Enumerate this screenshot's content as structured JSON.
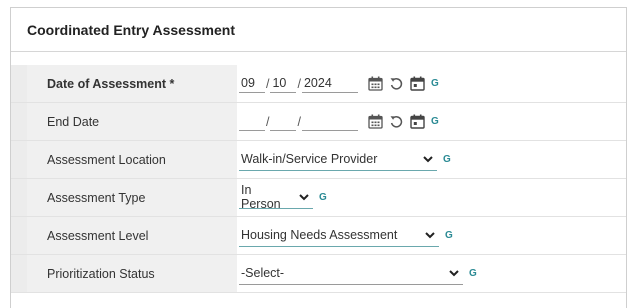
{
  "panel": {
    "title": "Coordinated Entry Assessment"
  },
  "rows": {
    "date_of_assessment": {
      "label": "Date of Assessment *",
      "month": "09",
      "day": "10",
      "year": "2024",
      "separator": "/",
      "g_label": "G"
    },
    "end_date": {
      "label": "End Date",
      "month": "",
      "day": "",
      "year": "",
      "separator": "/",
      "g_label": "G"
    },
    "assessment_location": {
      "label": "Assessment Location",
      "value": "Walk-in/Service Provider",
      "g_label": "G"
    },
    "assessment_type": {
      "label": "Assessment Type",
      "value": "In Person",
      "g_label": "G"
    },
    "assessment_level": {
      "label": "Assessment Level",
      "value": "Housing Needs Assessment",
      "g_label": "G"
    },
    "prioritization_status": {
      "label": "Prioritization Status",
      "value": "-Select-",
      "g_label": "G"
    }
  },
  "icons": {
    "calendar": "calendar-icon",
    "undo": "undo-icon",
    "today": "calendar-today-icon",
    "dropdown": "chevron-down-icon"
  },
  "colors": {
    "accent": "#2a8a94",
    "label_bg": "#f0f0f0",
    "underline_active": "#6aa8ad"
  }
}
